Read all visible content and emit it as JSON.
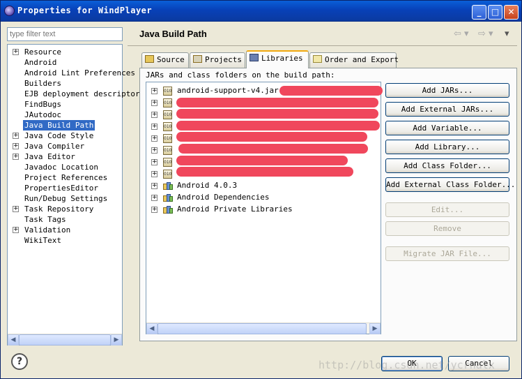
{
  "window": {
    "title": "Properties for WindPlayer",
    "controls": {
      "minimize": "_",
      "maximize": "□",
      "close": "✕"
    }
  },
  "sidebar": {
    "filter_placeholder": "type filter text",
    "items": [
      {
        "label": "Resource",
        "expandable": true
      },
      {
        "label": "Android",
        "expandable": false
      },
      {
        "label": "Android Lint Preferences",
        "expandable": false
      },
      {
        "label": "Builders",
        "expandable": false
      },
      {
        "label": "EJB deployment descriptor",
        "expandable": false
      },
      {
        "label": "FindBugs",
        "expandable": false
      },
      {
        "label": "JAutodoc",
        "expandable": false
      },
      {
        "label": "Java Build Path",
        "expandable": false,
        "selected": true
      },
      {
        "label": "Java Code Style",
        "expandable": true
      },
      {
        "label": "Java Compiler",
        "expandable": true
      },
      {
        "label": "Java Editor",
        "expandable": true
      },
      {
        "label": "Javadoc Location",
        "expandable": false
      },
      {
        "label": "Project References",
        "expandable": false
      },
      {
        "label": "PropertiesEditor",
        "expandable": false
      },
      {
        "label": "Run/Debug Settings",
        "expandable": false
      },
      {
        "label": "Task Repository",
        "expandable": true
      },
      {
        "label": "Task Tags",
        "expandable": false
      },
      {
        "label": "Validation",
        "expandable": true
      },
      {
        "label": "WikiText",
        "expandable": false
      }
    ]
  },
  "header": {
    "title": "Java Build Path",
    "back_arrow": "⇦ ▾",
    "forward_arrow": "⇨ ▾",
    "menu_arrow": "▾"
  },
  "tabs": [
    {
      "label": "Source",
      "active": false
    },
    {
      "label": "Projects",
      "active": false
    },
    {
      "label": "Libraries",
      "active": true
    },
    {
      "label": "Order and Export",
      "active": false
    }
  ],
  "libraries": {
    "caption": "JARs and class folders on the build path:",
    "rows": [
      {
        "label": "android-support-v4.jar - ",
        "kind": "jar"
      },
      {
        "label": "",
        "kind": "jar"
      },
      {
        "label": "",
        "kind": "jar"
      },
      {
        "label": "",
        "kind": "jar"
      },
      {
        "label": "",
        "kind": "jar"
      },
      {
        "label": "",
        "kind": "jar"
      },
      {
        "label": "",
        "kind": "jar"
      },
      {
        "label": "",
        "kind": "jar"
      },
      {
        "label": "Android 4.0.3",
        "kind": "library"
      },
      {
        "label": "Android Dependencies",
        "kind": "library"
      },
      {
        "label": "Android Private Libraries",
        "kind": "library"
      }
    ],
    "jar_icon_text": "010"
  },
  "buttons": [
    {
      "label": "Add JARs...",
      "enabled": true
    },
    {
      "label": "Add External JARs...",
      "enabled": true
    },
    {
      "label": "Add Variable...",
      "enabled": true
    },
    {
      "label": "Add Library...",
      "enabled": true
    },
    {
      "label": "Add Class Folder...",
      "enabled": true
    },
    {
      "label": "Add External Class Folder...",
      "enabled": true
    },
    {
      "label": "Edit...",
      "enabled": false
    },
    {
      "label": "Remove",
      "enabled": false
    },
    {
      "label": "Migrate JAR File...",
      "enabled": false
    }
  ],
  "footer": {
    "help_label": "?",
    "ok_label": "OK",
    "cancel_label": "Cancel",
    "watermark": "http://blog.csdn.net/ycrnalx"
  },
  "colors": {
    "titlebar": "#0a5fd8",
    "selection": "#316ac5",
    "redaction": "#f0475c",
    "tab_highlight": "#f1a80f"
  }
}
